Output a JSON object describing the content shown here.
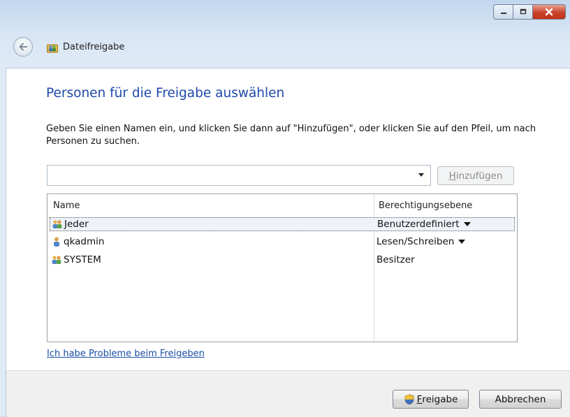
{
  "window": {
    "title": "Dateifreigabe",
    "controls": [
      "minimize",
      "maximize",
      "close"
    ]
  },
  "heading": "Personen für die Freigabe auswählen",
  "description": "Geben Sie einen Namen ein, und klicken Sie dann auf \"Hinzufügen\", oder klicken Sie auf den Pfeil, um nach Personen zu suchen.",
  "name_input": {
    "value": "",
    "placeholder": ""
  },
  "add_button": {
    "label_pre": "",
    "label_key": "H",
    "label_post": "inzufügen",
    "enabled": false
  },
  "list": {
    "columns": [
      "Name",
      "Berechtigungsebene"
    ],
    "rows": [
      {
        "name": "Jeder",
        "permission": "Benutzerdefiniert",
        "has_dropdown": true,
        "icon": "group-icon",
        "selected": true
      },
      {
        "name": "qkadmin",
        "permission": "Lesen/Schreiben",
        "has_dropdown": true,
        "icon": "user-icon",
        "selected": false
      },
      {
        "name": "SYSTEM",
        "permission": "Besitzer",
        "has_dropdown": false,
        "icon": "group-icon",
        "selected": false
      }
    ]
  },
  "help_link": "Ich habe Probleme beim Freigeben",
  "footer": {
    "share_button": {
      "label_key": "F",
      "label_post": "reigabe"
    },
    "cancel_button": "Abbrechen"
  },
  "colors": {
    "heading": "#1f49ab",
    "link": "#1a4ea5",
    "close_button": "#c6321a"
  }
}
